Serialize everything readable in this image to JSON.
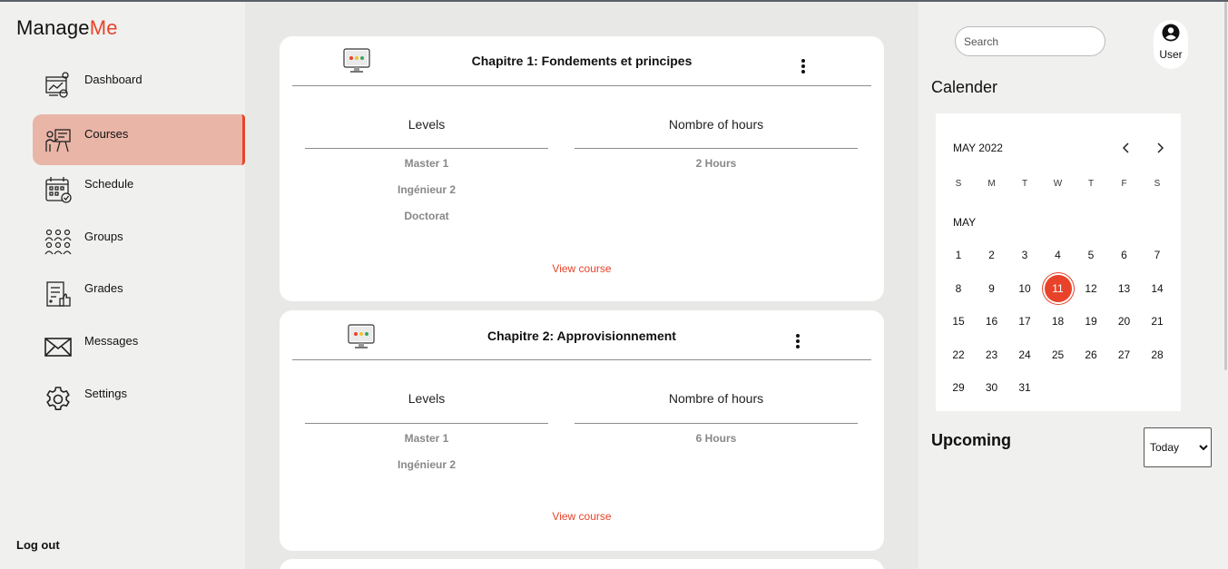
{
  "app": {
    "logo_main": "Manage",
    "logo_accent": "Me"
  },
  "sidebar": {
    "items": [
      {
        "label": "Dashboard",
        "icon": "dashboard-icon"
      },
      {
        "label": "Courses",
        "icon": "courses-icon",
        "active": true
      },
      {
        "label": "Schedule",
        "icon": "schedule-icon"
      },
      {
        "label": "Groups",
        "icon": "groups-icon"
      },
      {
        "label": "Grades",
        "icon": "grades-icon"
      },
      {
        "label": "Messages",
        "icon": "messages-icon"
      },
      {
        "label": "Settings",
        "icon": "settings-icon"
      }
    ],
    "logout_label": "Log out"
  },
  "courses": [
    {
      "title": "Chapitre 1: Fondements et principes",
      "levels_header": "Levels",
      "hours_header": "Nombre of hours",
      "levels": [
        "Master 1",
        "Ingénieur 2",
        "Doctorat"
      ],
      "hours": "2 Hours",
      "link": "View course"
    },
    {
      "title": "Chapitre 2: Approvisionnement",
      "levels_header": "Levels",
      "hours_header": "Nombre of hours",
      "levels": [
        "Master 1",
        "Ingénieur 2"
      ],
      "hours": "6 Hours",
      "link": "View course"
    }
  ],
  "header": {
    "search_placeholder": "Search",
    "user_label": "User"
  },
  "calendar": {
    "title": "Calender",
    "month_label": "MAY 2022",
    "sub_label": "MAY",
    "weekdays": [
      "S",
      "M",
      "T",
      "W",
      "T",
      "F",
      "S"
    ],
    "days": [
      "1",
      "2",
      "3",
      "4",
      "5",
      "6",
      "7",
      "8",
      "9",
      "10",
      "11",
      "12",
      "13",
      "14",
      "15",
      "16",
      "17",
      "18",
      "19",
      "20",
      "21",
      "22",
      "23",
      "24",
      "25",
      "26",
      "27",
      "28",
      "29",
      "30",
      "31"
    ],
    "selected_day": "11"
  },
  "upcoming": {
    "title": "Upcoming",
    "filter_value": "Today"
  },
  "colors": {
    "accent": "#e8432a",
    "active_bg": "#e9b5a7"
  }
}
